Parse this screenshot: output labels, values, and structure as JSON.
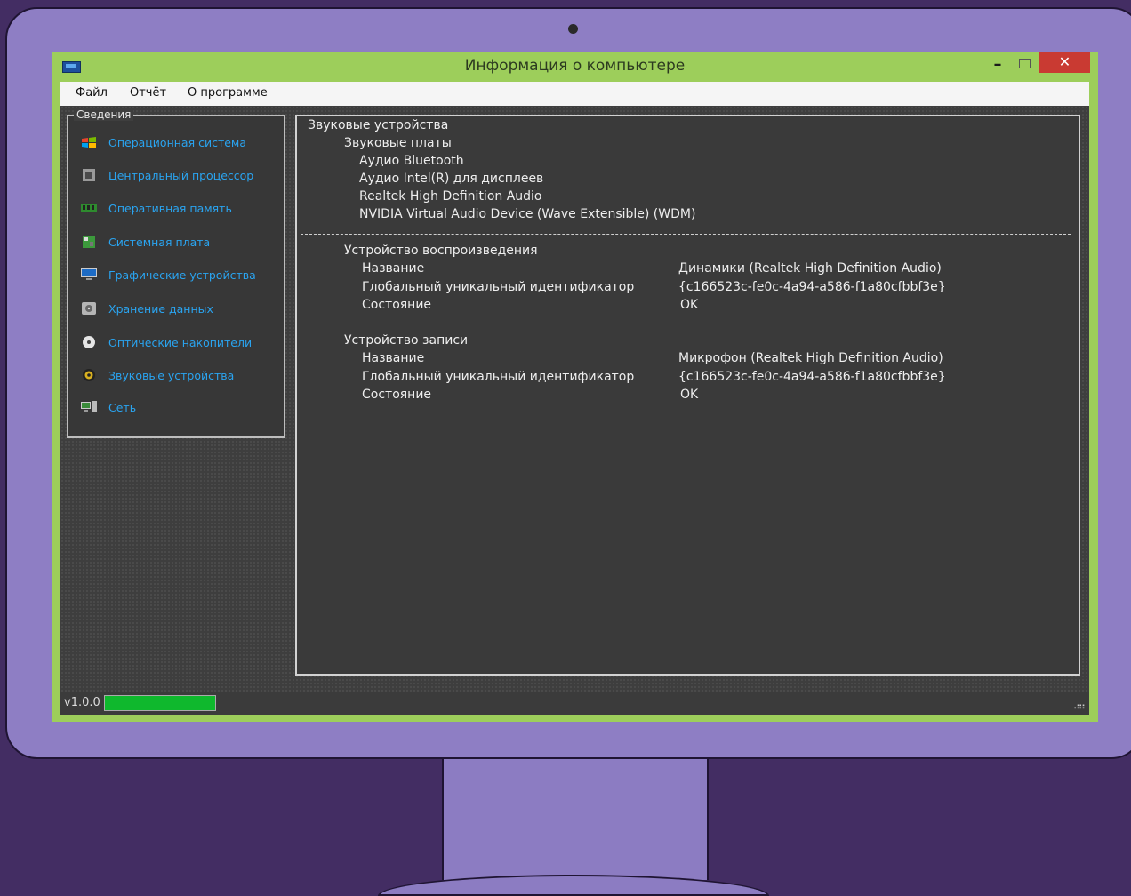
{
  "window": {
    "title": "Информация о компьютере",
    "minimize_glyph": "–",
    "close_glyph": "✕"
  },
  "menu": {
    "items": [
      "Файл",
      "Отчёт",
      "О программе"
    ]
  },
  "sidebar": {
    "group_title": "Сведения",
    "items": [
      {
        "label": "Операционная система",
        "icon": "windows-logo-icon"
      },
      {
        "label": "Центральный процессор",
        "icon": "cpu-icon"
      },
      {
        "label": "Оперативная память",
        "icon": "ram-icon"
      },
      {
        "label": "Системная плата",
        "icon": "motherboard-icon"
      },
      {
        "label": "Графические устройства",
        "icon": "monitor-icon"
      },
      {
        "label": "Хранение данных",
        "icon": "hard-drive-icon"
      },
      {
        "label": "Оптические накопители",
        "icon": "optical-disc-icon"
      },
      {
        "label": "Звуковые устройства",
        "icon": "speaker-icon"
      },
      {
        "label": "Сеть",
        "icon": "network-icon"
      }
    ],
    "label_color": "#2aa4f0"
  },
  "details": {
    "heading": "Звуковые устройства",
    "cards_heading": "Звуковые платы",
    "cards": [
      "Аудио Bluetooth",
      "Аудио Intel(R) для дисплеев",
      "Realtek High Definition Audio",
      "NVIDIA Virtual Audio Device (Wave Extensible) (WDM)"
    ],
    "playback": {
      "heading": "Устройство воспроизведения",
      "rows": [
        {
          "key": "Название",
          "value": "Динамики (Realtek High Definition Audio)"
        },
        {
          "key": "Глобальный уникальный идентификатор",
          "value": "{c166523c-fe0c-4a94-a586-f1a80cfbbf3e}"
        },
        {
          "key": "Состояние",
          "value": "OK"
        }
      ]
    },
    "recording": {
      "heading": "Устройство записи",
      "rows": [
        {
          "key": "Название",
          "value": "Микрофон (Realtek High Definition Audio)"
        },
        {
          "key": "Глобальный уникальный идентификатор",
          "value": "{c166523c-fe0c-4a94-a586-f1a80cfbbf3e}"
        },
        {
          "key": "Состояние",
          "value": "OK"
        }
      ]
    }
  },
  "status": {
    "version": "v1.0.0",
    "progress": 1.0,
    "progress_color": "#0fb82d"
  },
  "colors": {
    "window_frame": "#9dce5b",
    "close_button": "#c93a32",
    "monitor_bezel": "#8e7ec4",
    "background": "#432d63"
  }
}
